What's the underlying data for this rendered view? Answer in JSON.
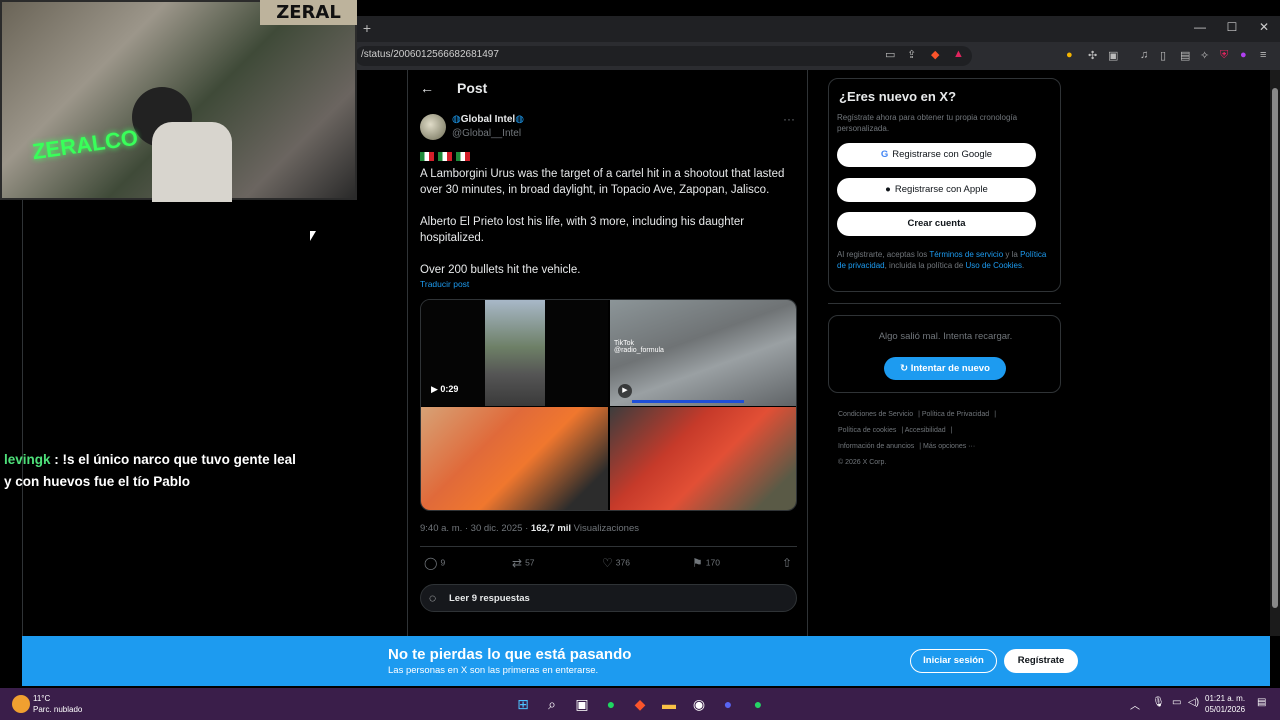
{
  "browser": {
    "url": "/status/2006012566682681497",
    "new_tab": "+"
  },
  "stream": {
    "channel_logo": "ZERAL",
    "neon_sign": "ZERALCO",
    "chat": {
      "user": "levingk",
      "message": ": !s el único narco que tuvo gente leal y con huevos fue el tío Pablo"
    }
  },
  "post": {
    "header": "Post",
    "author_name": "Global Intel",
    "author_handle": "@Global__Intel",
    "paragraphs": [
      "A Lamborgini Urus was the target of a cartel hit in a shootout that lasted over 30 minutes, in broad daylight, in Topacio Ave, Zapopan, Jalisco.",
      "Alberto El Prieto lost his life, with 3 more, including his daughter hospitalized.",
      "Over 200 bullets hit the vehicle."
    ],
    "translate": "Traducir post",
    "video_duration": "0:29",
    "tiktok_label": "TikTok",
    "tiktok_handle": "@radio_formula",
    "timestamp": "9:40 a. m. · 30 dic. 2025 · ",
    "views_count": "162,7 mil",
    "views_label": " Visualizaciones",
    "stats": {
      "replies": "9",
      "reposts": "57",
      "likes": "376",
      "bookmarks": "170"
    },
    "read_replies": "Leer 9 respuestas"
  },
  "sidebar": {
    "signup_title": "¿Eres nuevo en X?",
    "signup_desc": "Regístrate ahora para obtener tu propia cronología personalizada.",
    "google_btn": "Registrarse con Google",
    "apple_btn": "Registrarse con Apple",
    "create_btn": "Crear cuenta",
    "terms_pre": "Al registrarte, aceptas los ",
    "terms_link": "Términos de servicio",
    "terms_mid": " y la ",
    "privacy_link": "Política de privacidad",
    "terms_mid2": ", incluida la política de ",
    "cookies_link": "Uso de Cookies",
    "terms_end": ".",
    "error_msg": "Algo salió mal. Intenta recargar.",
    "retry_btn": "Intentar de nuevo",
    "footer": [
      "Condiciones de Servicio",
      "Política de Privacidad",
      "Política de cookies",
      "Accesibilidad",
      "Información de anuncios",
      "Más opciones ···",
      "© 2026 X Corp."
    ]
  },
  "banner": {
    "title": "No te pierdas lo que está pasando",
    "subtitle": "Las personas en X son las primeras en enterarse.",
    "login": "Iniciar sesión",
    "register": "Regístrate"
  },
  "taskbar": {
    "temp": "11°C",
    "weather": "Parc. nublado",
    "time": "01:21 a. m.",
    "date": "05/01/2026"
  },
  "colors": {
    "accent": "#1d9bf0",
    "background": "#000000",
    "taskbar": "#3a1e4a"
  }
}
